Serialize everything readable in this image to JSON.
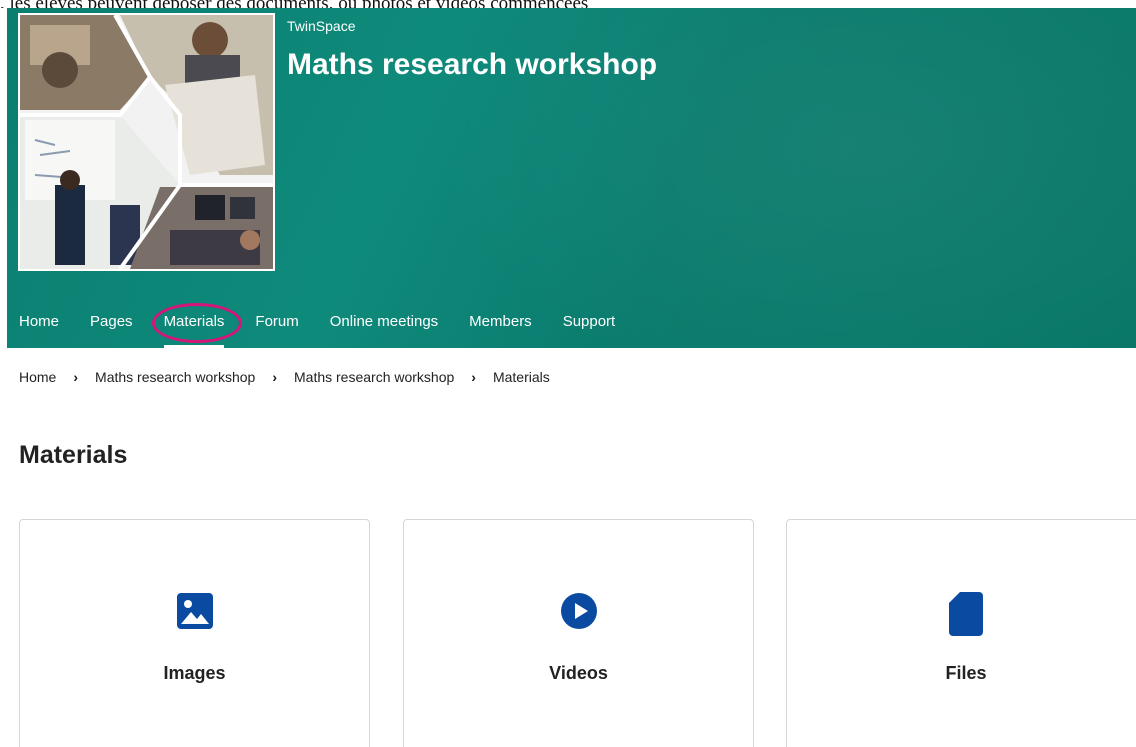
{
  "caption": ", les élèves peuvent déposer des documents, ou photos et vidéos commencées",
  "header": {
    "space_label": "TwinSpace",
    "project_title": "Maths research workshop"
  },
  "nav": {
    "items": [
      {
        "label": "Home"
      },
      {
        "label": "Pages"
      },
      {
        "label": "Materials"
      },
      {
        "label": "Forum"
      },
      {
        "label": "Online meetings"
      },
      {
        "label": "Members"
      },
      {
        "label": "Support"
      }
    ],
    "active": "Materials"
  },
  "breadcrumb": {
    "items": [
      {
        "label": "Home"
      },
      {
        "label": "Maths research workshop"
      },
      {
        "label": "Maths research workshop"
      },
      {
        "label": "Materials"
      }
    ],
    "separator": "›"
  },
  "main": {
    "title": "Materials",
    "cards": [
      {
        "label": "Images",
        "icon": "image-icon"
      },
      {
        "label": "Videos",
        "icon": "play-circle-icon"
      },
      {
        "label": "Files",
        "icon": "file-icon"
      }
    ]
  },
  "colors": {
    "banner": "#0b7f70",
    "highlight": "#d4157a",
    "icon": "#0a4aa0"
  }
}
